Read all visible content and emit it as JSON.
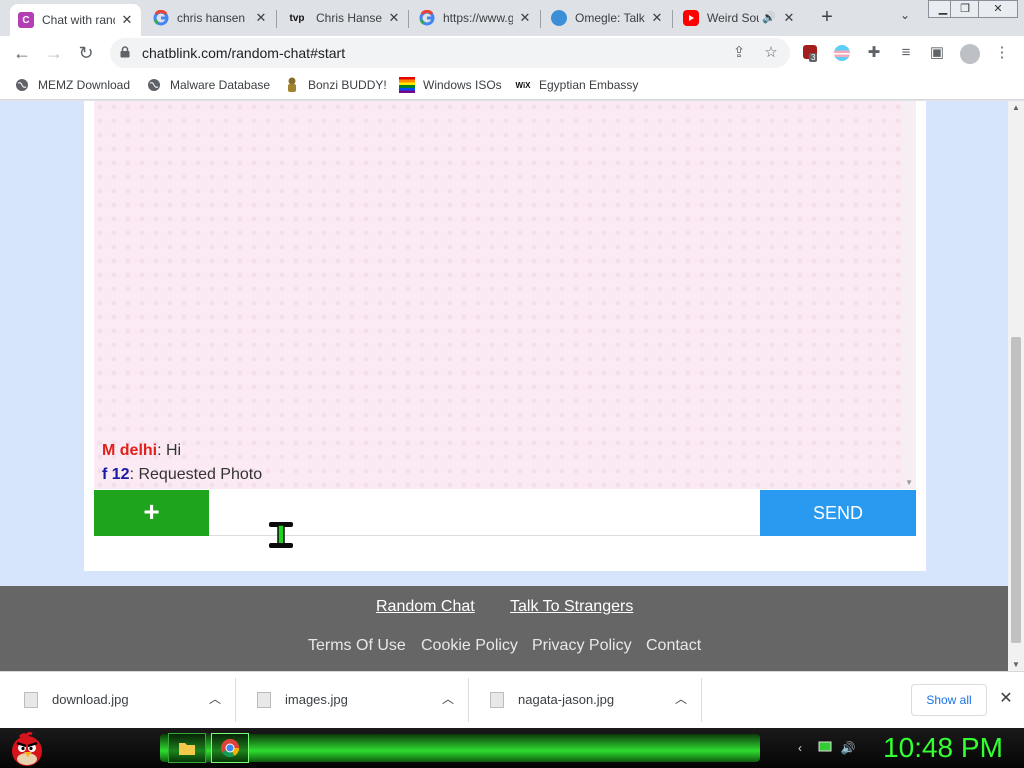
{
  "tabs": [
    {
      "title": "Chat with random strangers",
      "favicon": "chatblink-icon",
      "active": true
    },
    {
      "title": "chris hansen - Google Search",
      "favicon": "google-icon"
    },
    {
      "title": "Chris Hansen - TVP",
      "favicon": "tvp-icon"
    },
    {
      "title": "https://www.google.com",
      "favicon": "google-icon"
    },
    {
      "title": "Omegle: Talk to strangers",
      "favicon": "omegle-icon"
    },
    {
      "title": "Weird Sounds",
      "favicon": "youtube-icon"
    }
  ],
  "tab_favicon_letters": {
    "chatblink": "C",
    "tvp": "tvp"
  },
  "toolbar": {
    "url": "chatblink.com/random-chat#start",
    "extension_badge": "3"
  },
  "bookmarks": [
    {
      "label": "MEMZ Download",
      "icon": "globe-icon"
    },
    {
      "label": "Malware Database",
      "icon": "globe-icon"
    },
    {
      "label": "Bonzi BUDDY!",
      "icon": "bonzi-icon"
    },
    {
      "label": "Windows ISOs",
      "icon": "rainbow-flag-icon"
    },
    {
      "label": "Egyptian Embassy",
      "icon": "wix-icon"
    }
  ],
  "wix_icon_text": "WiX",
  "chat": {
    "messages": [
      {
        "nick": "M delhi",
        "nick_color": "#e0201b",
        "text": ": Hi"
      },
      {
        "nick": "f 12",
        "nick_color": "#1a1aa6",
        "text": ": Requested Photo"
      }
    ],
    "add_button": "+",
    "input_placeholder": "",
    "send_button": "SEND"
  },
  "footer": {
    "links_primary": [
      "Random Chat",
      "Talk To Strangers"
    ],
    "links_secondary": [
      "Terms Of Use",
      "Cookie Policy",
      "Privacy Policy",
      "Contact"
    ]
  },
  "downloads": {
    "items": [
      "download.jpg",
      "images.jpg",
      "nagata-jason.jpg"
    ],
    "show_all": "Show all"
  },
  "taskbar": {
    "clock": "10:48 PM"
  },
  "colors": {
    "add_button": "#1fa41d",
    "send_button": "#2a9af0",
    "page_bg": "#d6e4fc",
    "footer_bg": "#666666",
    "clock": "#33ff33"
  }
}
